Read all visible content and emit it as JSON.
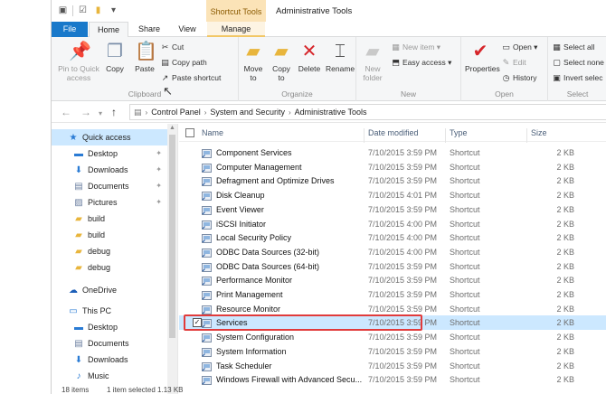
{
  "title_bar": {
    "context_tab": "Shortcut Tools",
    "window_title": "Administrative Tools"
  },
  "ribbon_tabs": [
    "File",
    "Home",
    "Share",
    "View",
    "Manage"
  ],
  "ribbon": {
    "clipboard": {
      "pin": "Pin to Quick access",
      "copy": "Copy",
      "paste": "Paste",
      "cut": "Cut",
      "copy_path": "Copy path",
      "paste_shortcut": "Paste shortcut",
      "label": "Clipboard"
    },
    "organize": {
      "move_to": "Move to",
      "copy_to": "Copy to",
      "delete": "Delete",
      "rename": "Rename",
      "label": "Organize"
    },
    "new": {
      "new_folder": "New folder",
      "new_item": "New item",
      "easy_access": "Easy access",
      "label": "New"
    },
    "open": {
      "properties": "Properties",
      "open": "Open",
      "edit": "Edit",
      "history": "History",
      "label": "Open"
    },
    "select": {
      "select_all": "Select all",
      "select_none": "Select none",
      "invert": "Invert selec",
      "label": "Select"
    }
  },
  "address": {
    "crumbs": [
      "Control Panel",
      "System and Security",
      "Administrative Tools"
    ]
  },
  "nav_pane": [
    {
      "label": "Quick access",
      "icon": "star-icon"
    },
    {
      "label": "Desktop",
      "icon": "desktop-icon"
    },
    {
      "label": "Downloads",
      "icon": "download-icon"
    },
    {
      "label": "Documents",
      "icon": "documents-icon"
    },
    {
      "label": "Pictures",
      "icon": "pictures-icon"
    },
    {
      "label": "build",
      "icon": "folder-icon"
    },
    {
      "label": "build",
      "icon": "folder-icon"
    },
    {
      "label": "debug",
      "icon": "folder-icon"
    },
    {
      "label": "debug",
      "icon": "folder-icon"
    },
    {
      "label": "OneDrive",
      "icon": "cloud-icon"
    },
    {
      "label": "This PC",
      "icon": "computer-icon"
    },
    {
      "label": "Desktop",
      "icon": "desktop-icon"
    },
    {
      "label": "Documents",
      "icon": "documents-icon"
    },
    {
      "label": "Downloads",
      "icon": "download-icon"
    },
    {
      "label": "Music",
      "icon": "music-icon"
    }
  ],
  "columns": [
    "Name",
    "Date modified",
    "Type",
    "Size"
  ],
  "files": [
    {
      "name": "Component Services",
      "date": "7/10/2015 3:59 PM",
      "type": "Shortcut",
      "size": "2 KB"
    },
    {
      "name": "Computer Management",
      "date": "7/10/2015 3:59 PM",
      "type": "Shortcut",
      "size": "2 KB"
    },
    {
      "name": "Defragment and Optimize Drives",
      "date": "7/10/2015 3:59 PM",
      "type": "Shortcut",
      "size": "2 KB"
    },
    {
      "name": "Disk Cleanup",
      "date": "7/10/2015 4:01 PM",
      "type": "Shortcut",
      "size": "2 KB"
    },
    {
      "name": "Event Viewer",
      "date": "7/10/2015 3:59 PM",
      "type": "Shortcut",
      "size": "2 KB"
    },
    {
      "name": "iSCSI Initiator",
      "date": "7/10/2015 4:00 PM",
      "type": "Shortcut",
      "size": "2 KB"
    },
    {
      "name": "Local Security Policy",
      "date": "7/10/2015 4:00 PM",
      "type": "Shortcut",
      "size": "2 KB"
    },
    {
      "name": "ODBC Data Sources (32-bit)",
      "date": "7/10/2015 4:00 PM",
      "type": "Shortcut",
      "size": "2 KB"
    },
    {
      "name": "ODBC Data Sources (64-bit)",
      "date": "7/10/2015 3:59 PM",
      "type": "Shortcut",
      "size": "2 KB"
    },
    {
      "name": "Performance Monitor",
      "date": "7/10/2015 3:59 PM",
      "type": "Shortcut",
      "size": "2 KB"
    },
    {
      "name": "Print Management",
      "date": "7/10/2015 3:59 PM",
      "type": "Shortcut",
      "size": "2 KB"
    },
    {
      "name": "Resource Monitor",
      "date": "7/10/2015 3:59 PM",
      "type": "Shortcut",
      "size": "2 KB"
    },
    {
      "name": "Services",
      "date": "7/10/2015 3:59 PM",
      "type": "Shortcut",
      "size": "2 KB",
      "selected": true
    },
    {
      "name": "System Configuration",
      "date": "7/10/2015 3:59 PM",
      "type": "Shortcut",
      "size": "2 KB"
    },
    {
      "name": "System Information",
      "date": "7/10/2015 3:59 PM",
      "type": "Shortcut",
      "size": "2 KB"
    },
    {
      "name": "Task Scheduler",
      "date": "7/10/2015 3:59 PM",
      "type": "Shortcut",
      "size": "2 KB"
    },
    {
      "name": "Windows Firewall with Advanced Secu...",
      "date": "7/10/2015 3:59 PM",
      "type": "Shortcut",
      "size": "2 KB"
    }
  ],
  "status": {
    "items": "18 items",
    "selected": "1 item selected  1.13 KB"
  },
  "colors": {
    "file_tab": "#1979ca",
    "selection": "#cce8ff",
    "highlight_border": "#e13b3b",
    "context_tab": "#fbe3b7"
  }
}
